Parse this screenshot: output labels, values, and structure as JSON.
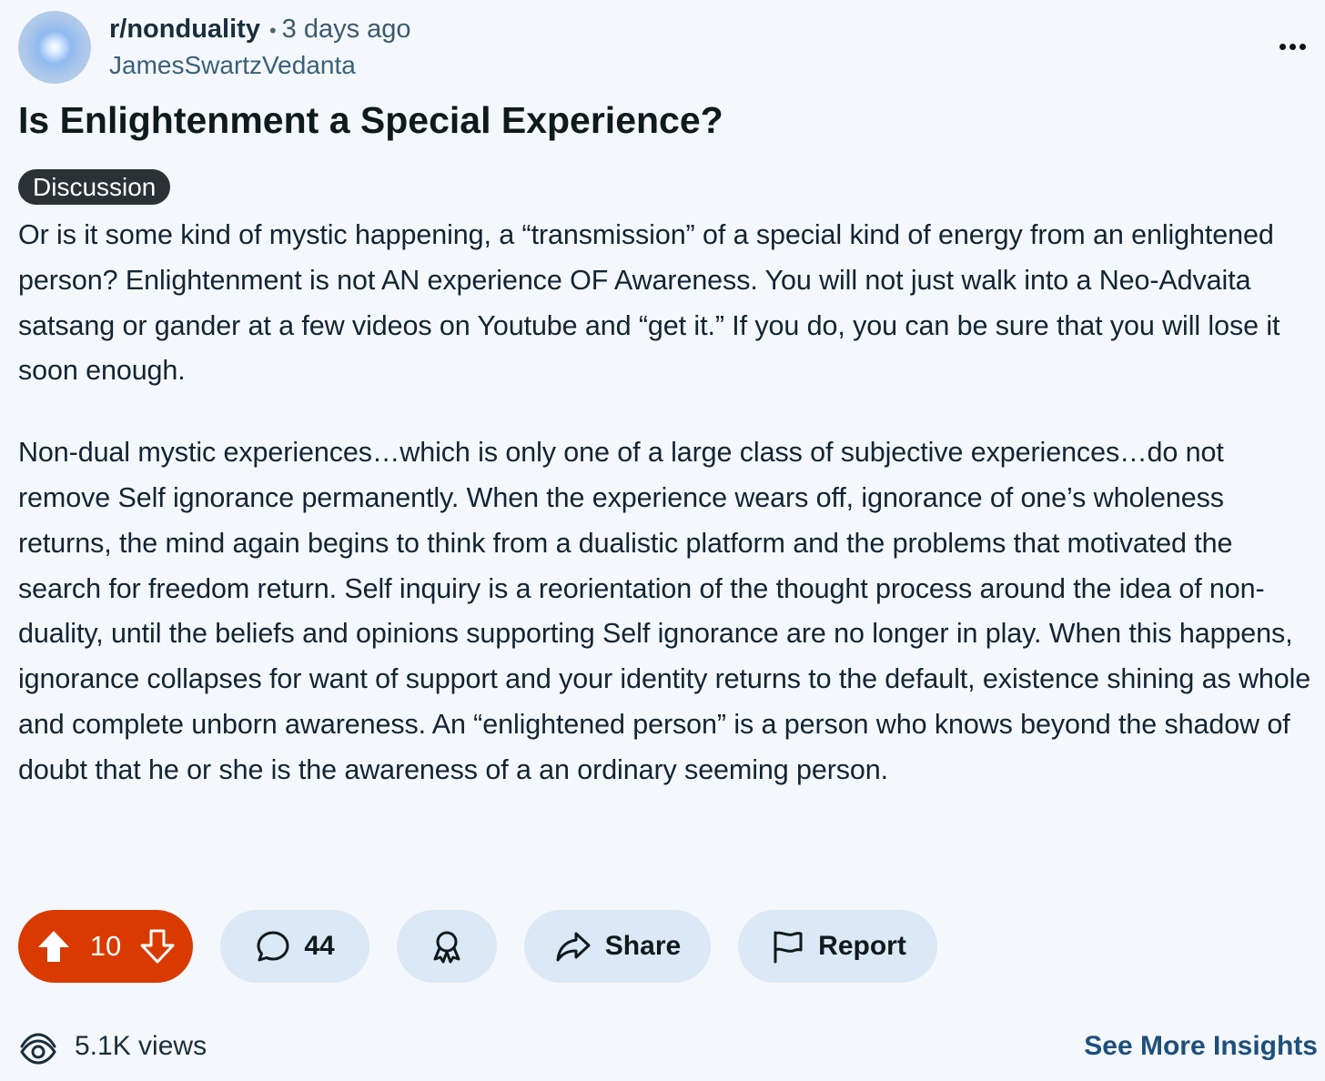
{
  "post": {
    "subreddit": "r/nonduality",
    "separator": "•",
    "time_ago": "3 days ago",
    "author": "JamesSwartzVedanta",
    "title": "Is Enlightenment a Special Experience?",
    "flair": "Discussion",
    "paragraphs": [
      "Or is it some kind of mystic happening, a “transmission” of a special kind of energy from an enlightened person? Enlightenment is not AN experience OF Awareness. You will not just walk into a Neo-Advaita satsang or gander at a few videos on Youtube and “get it.” If you do, you can be sure that you will lose it soon enough.",
      "Non-dual mystic experiences…which is only one of a large class of subjective experiences…do not remove Self ignorance permanently. When the experience wears off, ignorance of one’s wholeness returns, the mind again begins to think from a dualistic platform and the problems that motivated the search for freedom return. Self inquiry is a reorientation of the thought process around the idea of non-duality, until the beliefs and opinions supporting Self ignorance are no longer in play. When this happens, ignorance collapses for want of support and your identity returns to the default, existence shining as whole and complete unborn awareness. An “enlightened person” is a person who knows beyond the shadow of doubt that he or she is the awareness of a an ordinary seeming person."
    ]
  },
  "actions": {
    "vote_count": "10",
    "comment_count": "44",
    "share_label": "Share",
    "report_label": "Report"
  },
  "footer": {
    "views": "5.1K views",
    "insights_label": "See More Insights"
  },
  "colors": {
    "background": "#f4f8fc",
    "upvote_active": "#d93a00",
    "pill": "#dbe8f5",
    "flair": "#2c3135",
    "link": "#1f4f7a"
  },
  "icons": [
    "overflow-menu-icon",
    "upvote-icon",
    "downvote-icon",
    "comment-icon",
    "award-icon",
    "share-icon",
    "report-flag-icon",
    "views-icon"
  ]
}
